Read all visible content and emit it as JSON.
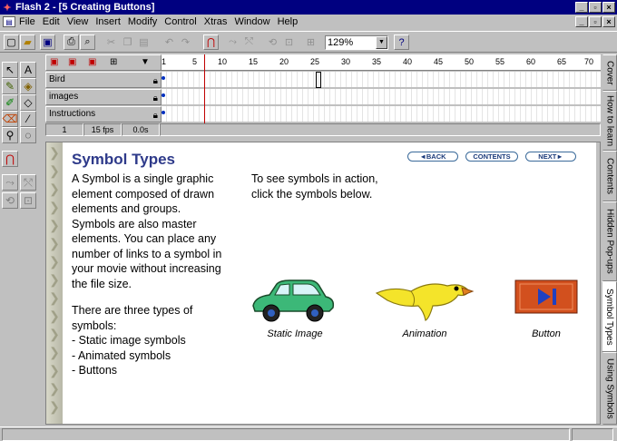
{
  "window": {
    "title": "Flash 2 - [5 Creating Buttons]"
  },
  "menu": [
    "File",
    "Edit",
    "View",
    "Insert",
    "Modify",
    "Control",
    "Xtras",
    "Window",
    "Help"
  ],
  "toolbar": {
    "zoom": "129%"
  },
  "timeline": {
    "ruler_ticks": [
      "1",
      "5",
      "10",
      "15",
      "20",
      "25",
      "30",
      "35",
      "40",
      "45",
      "50",
      "55",
      "60",
      "65",
      "70"
    ],
    "layers": [
      {
        "name": "Bird"
      },
      {
        "name": "images"
      },
      {
        "name": "Instructions"
      }
    ],
    "status": {
      "frame": "1",
      "fps": "15 fps",
      "time": "0.0s"
    }
  },
  "tabs": [
    "Cover",
    "How to learn",
    "Contents",
    "Hidden Pop-ups",
    "Symbol Types",
    "Using Symbols"
  ],
  "stage": {
    "title": "Symbol Types",
    "nav": {
      "back": "◄BACK",
      "contents": "CONTENTS",
      "next": "NEXT►"
    },
    "intro": [
      "A Symbol is a single graphic",
      "element composed of drawn",
      "elements and groups.",
      "Symbols are also master",
      "elements. You can place any",
      "number of links to a symbol in",
      "your movie without increasing",
      "the file size."
    ],
    "types_intro": [
      "There are three types of",
      "symbols:"
    ],
    "types": [
      "- Static image symbols",
      "- Animated symbols",
      "- Buttons"
    ],
    "action": [
      "To see symbols in action,",
      "click the symbols below."
    ],
    "captions": {
      "static": "Static Image",
      "animation": "Animation",
      "button": "Button"
    }
  },
  "colors": {
    "titlebar": "#000080",
    "heading": "#2e3a8a",
    "car": "#3cb878",
    "bird": "#f4e42a",
    "button_bg": "#d2501e"
  }
}
